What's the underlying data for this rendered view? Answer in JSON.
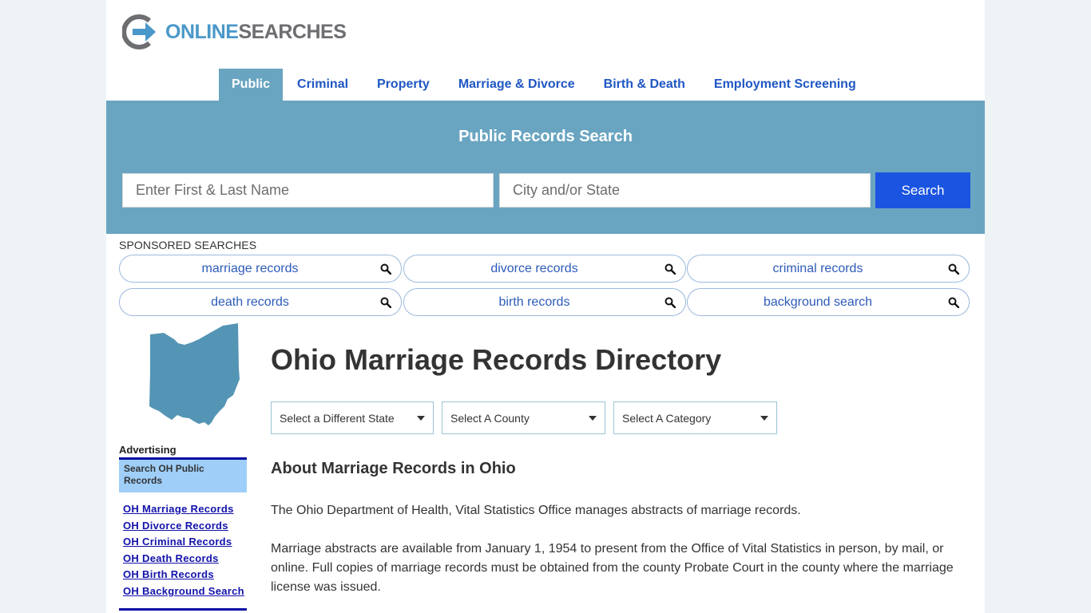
{
  "brand": {
    "part1": "ONLINE",
    "part2": "SEARCHES"
  },
  "nav": [
    {
      "label": "Public",
      "active": true
    },
    {
      "label": "Criminal"
    },
    {
      "label": "Property"
    },
    {
      "label": "Marriage & Divorce"
    },
    {
      "label": "Birth & Death"
    },
    {
      "label": "Employment Screening"
    }
  ],
  "hero": {
    "title": "Public Records Search",
    "name_placeholder": "Enter First & Last Name",
    "city_placeholder": "City and/or State",
    "search_label": "Search"
  },
  "sponsored": {
    "label": "SPONSORED SEARCHES",
    "items": [
      "marriage records",
      "divorce records",
      "criminal records",
      "death records",
      "birth records",
      "background search"
    ]
  },
  "sidebar": {
    "advertising_label": "Advertising",
    "box_label": "Search OH Public Records",
    "links": [
      "OH Marriage Records",
      "OH Divorce Records",
      "OH Criminal Records",
      "OH Death Records",
      "OH Birth Records",
      "OH Background Search"
    ]
  },
  "main": {
    "title": "Ohio Marriage Records Directory",
    "selects": [
      "Select a Different State",
      "Select A County",
      "Select A Category"
    ],
    "section_title": "About Marriage Records in Ohio",
    "paragraphs": [
      "The Ohio Department of Health, Vital Statistics Office manages abstracts of marriage records.",
      "Marriage abstracts are available from January 1, 1954 to present from the Office of Vital Statistics in person, by mail, or online. Full copies of marriage records must be obtained from the county Probate Court in the county where the marriage license was issued."
    ]
  },
  "colors": {
    "accent": "#69a5c1",
    "nav_link": "#1f57c3",
    "search_button": "#1b54e1",
    "sidebar_link": "#1212aa",
    "map_fill": "#5495b5"
  }
}
